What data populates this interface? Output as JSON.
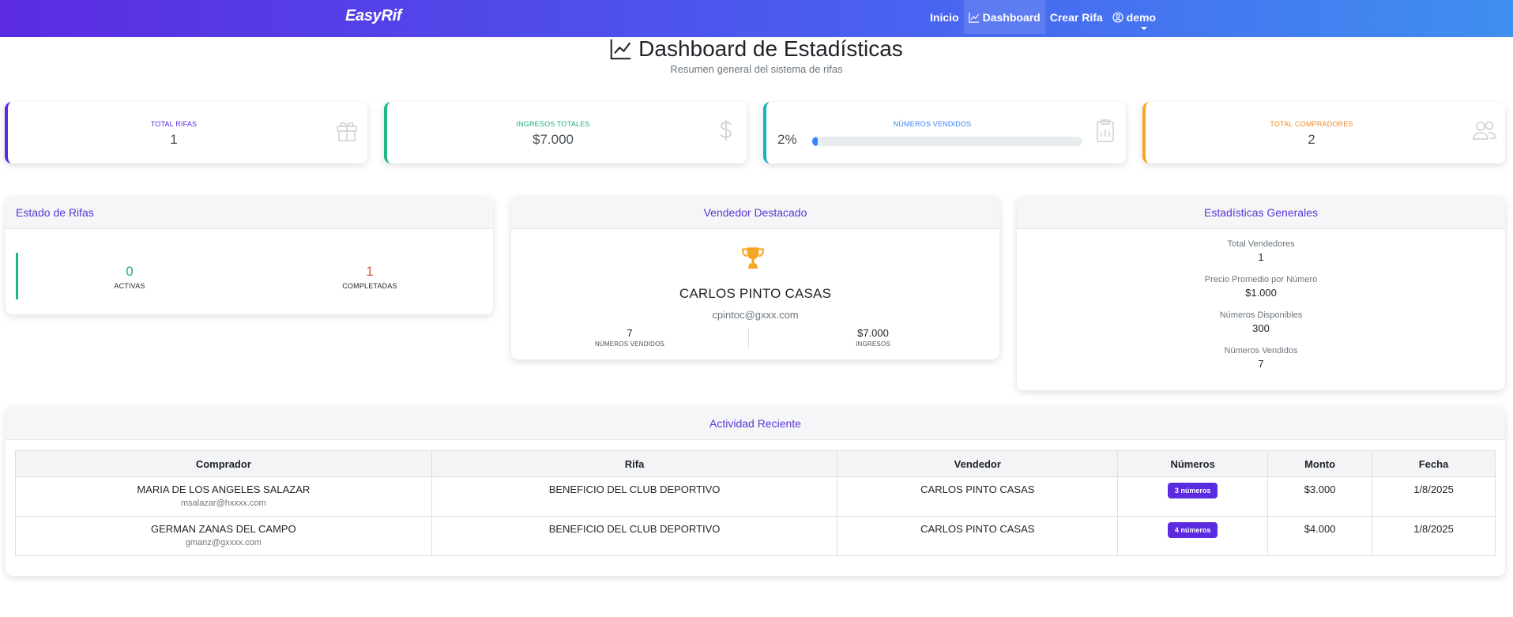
{
  "nav": {
    "brand": "EasyRif",
    "links": [
      "Inicio",
      "Dashboard",
      "Crear Rifa"
    ],
    "user": "demo"
  },
  "header": {
    "title": "Dashboard de Estadísticas",
    "subtitle": "Resumen general del sistema de rifas"
  },
  "stats": {
    "total_rifas": {
      "label": "TOTAL RIFAS",
      "value": "1",
      "color": "#5b2be0",
      "icon": "gift-icon"
    },
    "ingresos": {
      "label": "INGRESOS TOTALES",
      "value": "$7.000",
      "color": "#1fb87f",
      "icon": "dollar-icon"
    },
    "vendidos": {
      "label": "NÚMEROS VENDIDOS",
      "value": "2%",
      "progress": 0.02,
      "color": "#17b2c0",
      "icon": "clipboard-chart-icon"
    },
    "compradores": {
      "label": "TOTAL COMPRADORES",
      "value": "2",
      "color": "#f5a623",
      "icon": "users-icon"
    }
  },
  "estado": {
    "title": "Estado de Rifas",
    "activas": {
      "value": "0",
      "label": "ACTIVAS",
      "color": "#1fae74"
    },
    "completadas": {
      "value": "1",
      "label": "COMPLETADAS",
      "color": "#e0543a"
    }
  },
  "vendedor": {
    "title": "Vendedor Destacado",
    "name": "CARLOS PINTO CASAS",
    "email": "cpintoc@gxxx.com",
    "numeros": {
      "value": "7",
      "label": "NÚMEROS VENDIDOS"
    },
    "ingresos": {
      "value": "$7.000",
      "label": "INGRESOS"
    }
  },
  "generales": {
    "title": "Estadísticas Generales",
    "items": [
      {
        "label": "Total Vendedores",
        "value": "1"
      },
      {
        "label": "Precio Promedio por Número",
        "value": "$1.000"
      },
      {
        "label": "Números Disponibles",
        "value": "300"
      },
      {
        "label": "Números Vendidos",
        "value": "7"
      }
    ]
  },
  "actividad": {
    "title": "Actividad Reciente",
    "columns": [
      "Comprador",
      "Rifa",
      "Vendedor",
      "Números",
      "Monto",
      "Fecha"
    ],
    "rows": [
      {
        "buyer": "MARIA DE LOS ANGELES SALAZAR",
        "email": "msalazar@hxxxx.com",
        "rifa": "BENEFICIO DEL CLUB DEPORTIVO",
        "vendedor": "CARLOS PINTO CASAS",
        "numeros": "3 números",
        "monto": "$3.000",
        "fecha": "1/8/2025"
      },
      {
        "buyer": "GERMAN ZANAS DEL CAMPO",
        "email": "gmanz@gxxxx.com",
        "rifa": "BENEFICIO DEL CLUB DEPORTIVO",
        "vendedor": "CARLOS PINTO CASAS",
        "numeros": "4 números",
        "monto": "$4.000",
        "fecha": "1/8/2025"
      }
    ]
  }
}
